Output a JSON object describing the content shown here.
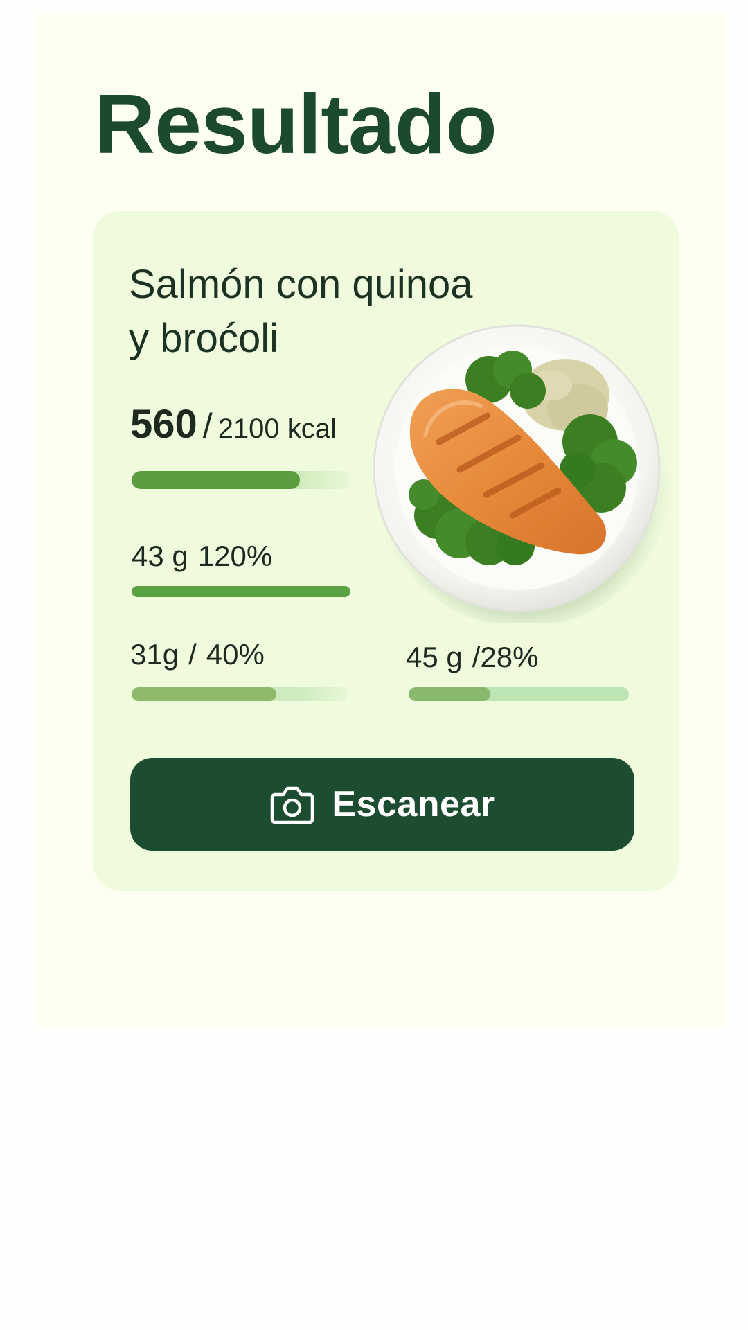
{
  "header": {
    "title": "Resultado"
  },
  "result": {
    "dish_name_line1": "Salmón con quinoa",
    "dish_name_line2": "y broćoli",
    "calories": {
      "value": "560",
      "separator": "/",
      "goal": "2100 kcal",
      "progress_fraction": 0.77
    },
    "macros": [
      {
        "amount": "43 g",
        "percent": "120%",
        "progress_fraction": 1.0
      },
      {
        "amount": "31g",
        "separator": "/",
        "percent": "40%",
        "progress_fraction": 0.67
      },
      {
        "amount": "45 g",
        "separator": "/",
        "percent": "28%",
        "progress_fraction": 0.37
      }
    ],
    "image_icon": "plate-of-food-illustration"
  },
  "actions": {
    "scan_label": "Escanear",
    "scan_icon": "camera-icon"
  },
  "colors": {
    "background": "#fefefc",
    "panel": "#fdfff1",
    "card": "#f0fbdd",
    "title": "#1b4a2d",
    "button": "#1d4d31",
    "bar_dark": "#5a9e3e",
    "bar_light": "#b6dea0"
  }
}
